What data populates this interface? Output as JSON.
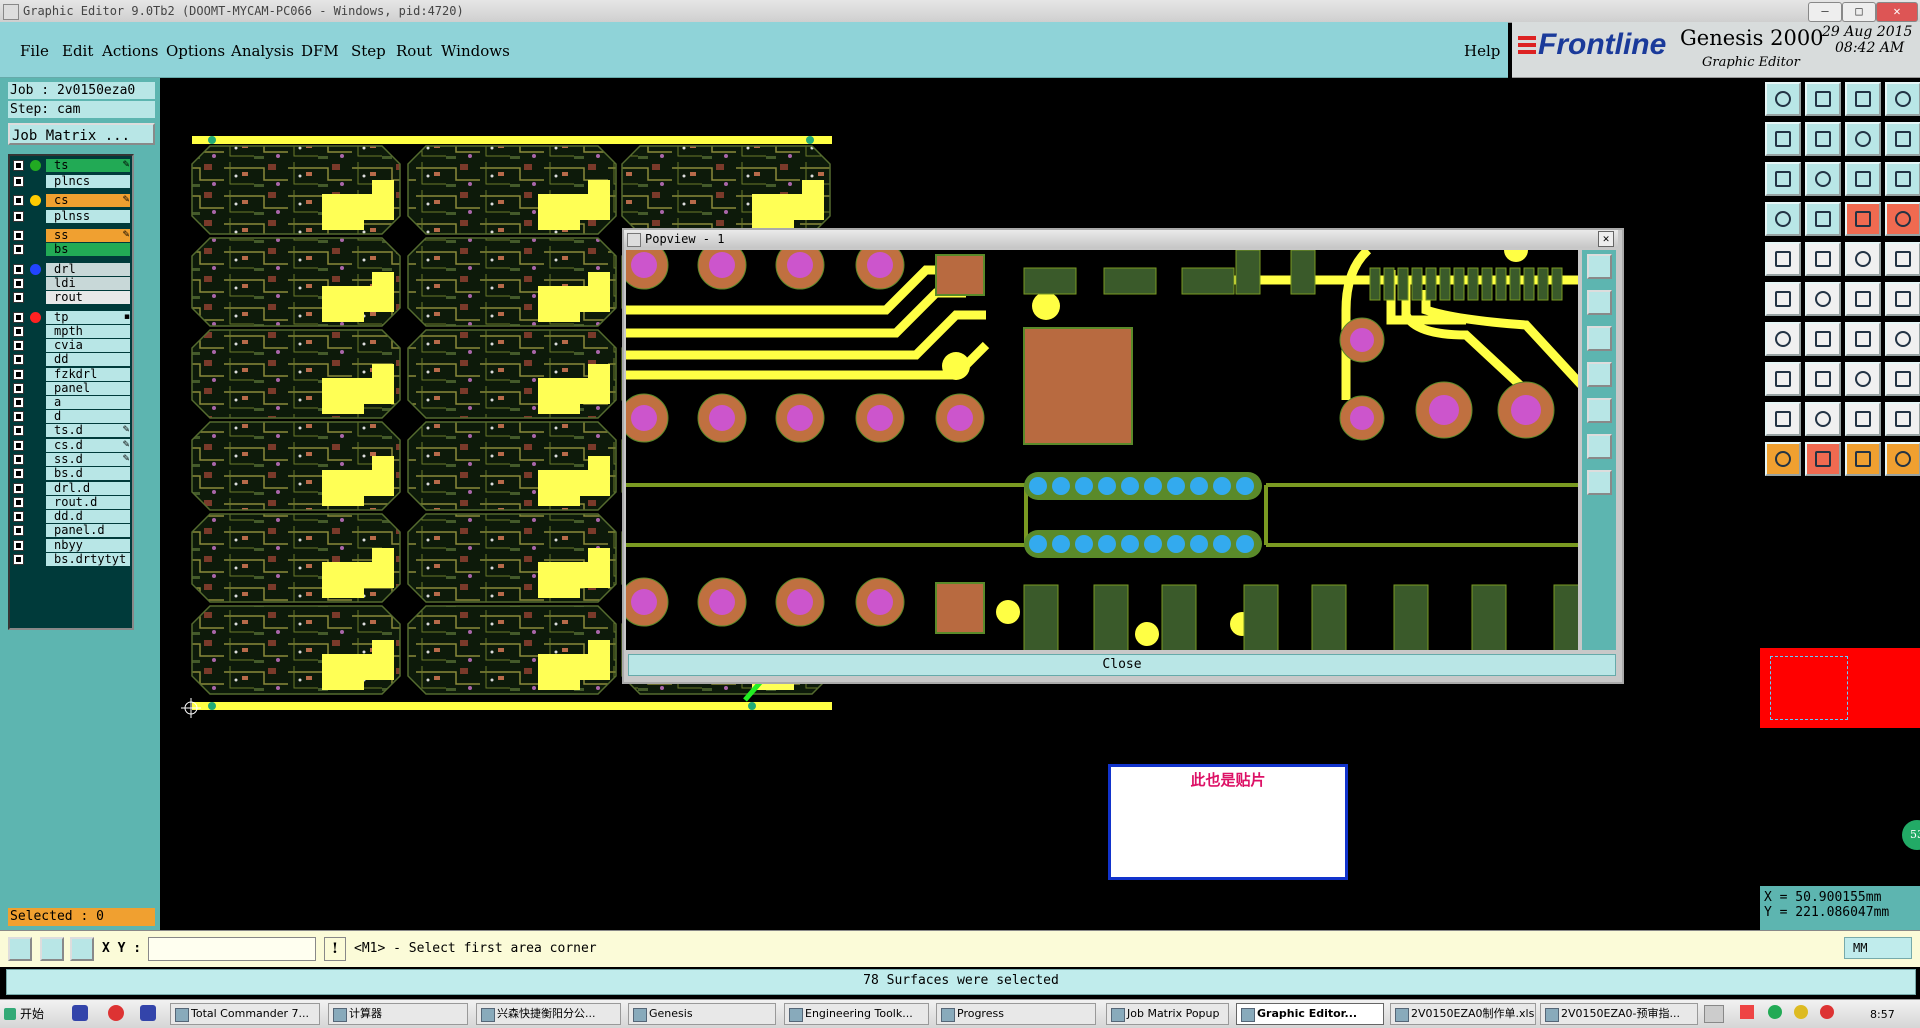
{
  "window": {
    "title": "Graphic Editor 9.0Tb2 (DOOMT-MYCAM-PC066 - Windows, pid:4720)"
  },
  "menu": {
    "file": "File",
    "edit": "Edit",
    "actions": "Actions",
    "options": "Options",
    "analysis": "Analysis",
    "dfm": "DFM",
    "step": "Step",
    "rout": "Rout",
    "windows": "Windows",
    "help": "Help"
  },
  "brand": {
    "logo": "Frontline",
    "product": "Genesis 2000",
    "subtitle": "Graphic Editor",
    "date": "29 Aug 2015",
    "time": "08:42 AM"
  },
  "job": {
    "job_label": "Job : 2v0150eza0",
    "step_label": "Step: cam",
    "matrix_button": "Job Matrix ..."
  },
  "layers": [
    {
      "name": "ts",
      "dot": "#22aa22",
      "bg": "#22aa55",
      "flag": "✎"
    },
    {
      "name": "plncs",
      "dot": "",
      "bg": "#b8e6e6",
      "flag": ""
    },
    {
      "name": "cs",
      "dot": "#ffcc00",
      "bg": "#f0a030",
      "flag": "✎"
    },
    {
      "name": "plnss",
      "dot": "",
      "bg": "#b8e6e6",
      "flag": ""
    },
    {
      "name": "ss",
      "dot": "",
      "bg": "#f0a030",
      "flag": "✎"
    },
    {
      "name": "bs",
      "dot": "",
      "bg": "#22aa55",
      "flag": ""
    },
    {
      "name": "drl",
      "dot": "#2244ff",
      "bg": "#c8d8d8",
      "flag": ""
    },
    {
      "name": "ldi",
      "dot": "",
      "bg": "#c8d8d8",
      "flag": ""
    },
    {
      "name": "rout",
      "dot": "",
      "bg": "#e8e8e8",
      "flag": ""
    },
    {
      "name": "tp",
      "dot": "#ff2222",
      "bg": "#b8e6e6",
      "flag": "▪"
    },
    {
      "name": "mpth",
      "dot": "",
      "bg": "#b8e6e6",
      "flag": ""
    },
    {
      "name": "cvia",
      "dot": "",
      "bg": "#b8e6e6",
      "flag": ""
    },
    {
      "name": "dd",
      "dot": "",
      "bg": "#b8e6e6",
      "flag": ""
    },
    {
      "name": "fzkdrl",
      "dot": "",
      "bg": "#b8e6e6",
      "flag": ""
    },
    {
      "name": "panel",
      "dot": "",
      "bg": "#b8e6e6",
      "flag": ""
    },
    {
      "name": "a",
      "dot": "",
      "bg": "#b8e6e6",
      "flag": ""
    },
    {
      "name": "d",
      "dot": "",
      "bg": "#b8e6e6",
      "flag": ""
    },
    {
      "name": "ts.d",
      "dot": "",
      "bg": "#b8e6e6",
      "flag": "✎"
    },
    {
      "name": "cs.d",
      "dot": "",
      "bg": "#b8e6e6",
      "flag": "✎"
    },
    {
      "name": "ss.d",
      "dot": "",
      "bg": "#b8e6e6",
      "flag": "✎"
    },
    {
      "name": "bs.d",
      "dot": "",
      "bg": "#b8e6e6",
      "flag": ""
    },
    {
      "name": "drl.d",
      "dot": "",
      "bg": "#b8e6e6",
      "flag": ""
    },
    {
      "name": "rout.d",
      "dot": "",
      "bg": "#b8e6e6",
      "flag": ""
    },
    {
      "name": "dd.d",
      "dot": "",
      "bg": "#b8e6e6",
      "flag": ""
    },
    {
      "name": "panel.d",
      "dot": "",
      "bg": "#b8e6e6",
      "flag": ""
    },
    {
      "name": "nbyy",
      "dot": "",
      "bg": "#b8e6e6",
      "flag": ""
    },
    {
      "name": "bs.drtytyt",
      "dot": "",
      "bg": "#b8e6e6",
      "flag": ""
    }
  ],
  "selected_label": "Selected : 0",
  "popview": {
    "title": "Popview - 1",
    "close_label": "Close"
  },
  "annotation": {
    "text": "此也是贴片"
  },
  "coords": {
    "x": "X = 50.900155mm",
    "y": "Y = 221.086047mm"
  },
  "status": {
    "xy_label": "X Y :",
    "xy_value": "",
    "prompt": "<M1> - Select first area corner",
    "unit": "MM"
  },
  "message": "78 Surfaces were selected",
  "taskbar": {
    "start": "开始",
    "tasks": [
      "Total Commander 7...",
      "计算器",
      "兴森快捷衡阳分公...",
      "Genesis",
      "Engineering Toolk...",
      "Progress",
      "Job Matrix Popup",
      "Graphic Editor...",
      "2V0150EZA0制作单.xls",
      "2V0150EZA0-预审指..."
    ],
    "clock": "8:57"
  },
  "colors": {
    "accent": "#8fd3d8",
    "trace": "#ffff44",
    "pad": "#c07040",
    "via": "#cc55cc",
    "arrow": "#22ee22",
    "selection": "#ff0000"
  }
}
